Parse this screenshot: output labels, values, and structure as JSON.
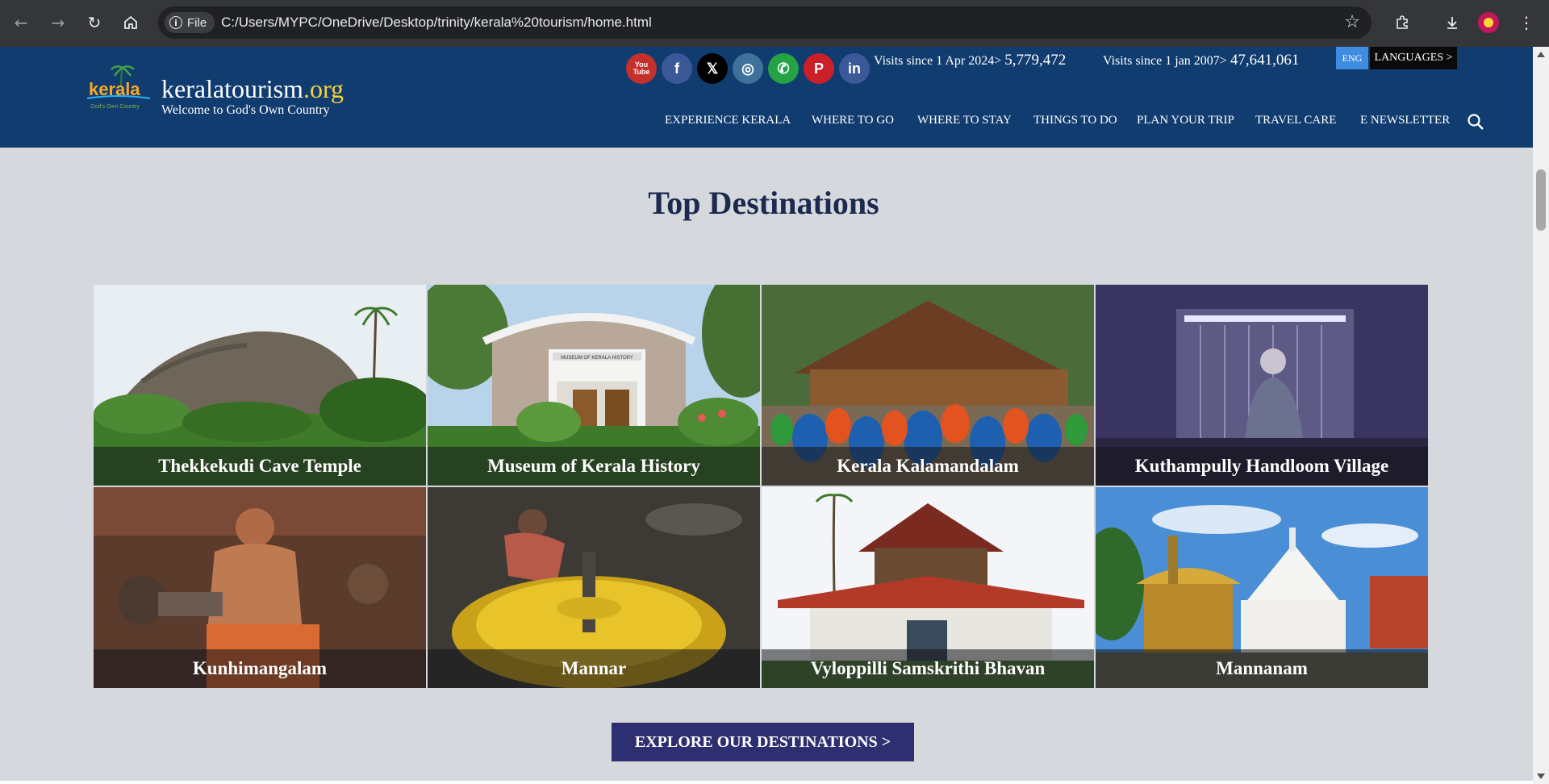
{
  "browser": {
    "file_chip": "File",
    "url": "C:/Users/MYPC/OneDrive/Desktop/trinity/kerala%20tourism/home.html"
  },
  "header": {
    "site_name": "keralatourism",
    "site_tld": ".org",
    "tagline": "Welcome to God's Own Country",
    "logo_text": "kerala",
    "logo_subtext": "God's Own Country",
    "social": [
      {
        "name": "youtube-icon",
        "glyph": "You Tube",
        "color": "#c4302b"
      },
      {
        "name": "facebook-icon",
        "glyph": "f",
        "color": "#3b5998"
      },
      {
        "name": "x-icon",
        "glyph": "𝕏",
        "color": "#000000"
      },
      {
        "name": "instagram-icon",
        "glyph": "◎",
        "color": "#3f729b"
      },
      {
        "name": "whatsapp-icon",
        "glyph": "✆",
        "color": "#25a244"
      },
      {
        "name": "pinterest-icon",
        "glyph": "P",
        "color": "#cb2027"
      },
      {
        "name": "linkedin-icon",
        "glyph": "in",
        "color": "#3b5998"
      }
    ],
    "visits_2024_label": "Visits since 1 Apr 2024>",
    "visits_2024_count": "5,779,472",
    "visits_2007_label": "Visits since 1 jan 2007>",
    "visits_2007_count": "47,641,061",
    "lang_current": "ENG",
    "lang_button": "LANGUAGES >",
    "menu": [
      "EXPERIENCE KERALA",
      "WHERE TO GO",
      "WHERE TO STAY",
      "THINGS TO DO",
      "PLAN YOUR TRIP",
      "TRAVEL CARE",
      "E NEWSLETTER"
    ]
  },
  "main": {
    "title": "Top Destinations",
    "destinations": [
      {
        "name": "Thekkekudi Cave Temple"
      },
      {
        "name": "Museum of Kerala History",
        "sign": "MUSEUM OF KERALA HISTORY"
      },
      {
        "name": "Kerala Kalamandalam"
      },
      {
        "name": "Kuthampully Handloom Village"
      },
      {
        "name": "Kunhimangalam"
      },
      {
        "name": "Mannar"
      },
      {
        "name": "Vyloppilli Samskrithi Bhavan"
      },
      {
        "name": "Mannanam"
      }
    ],
    "explore_button": "EXPLORE OUR DESTINATIONS >"
  }
}
